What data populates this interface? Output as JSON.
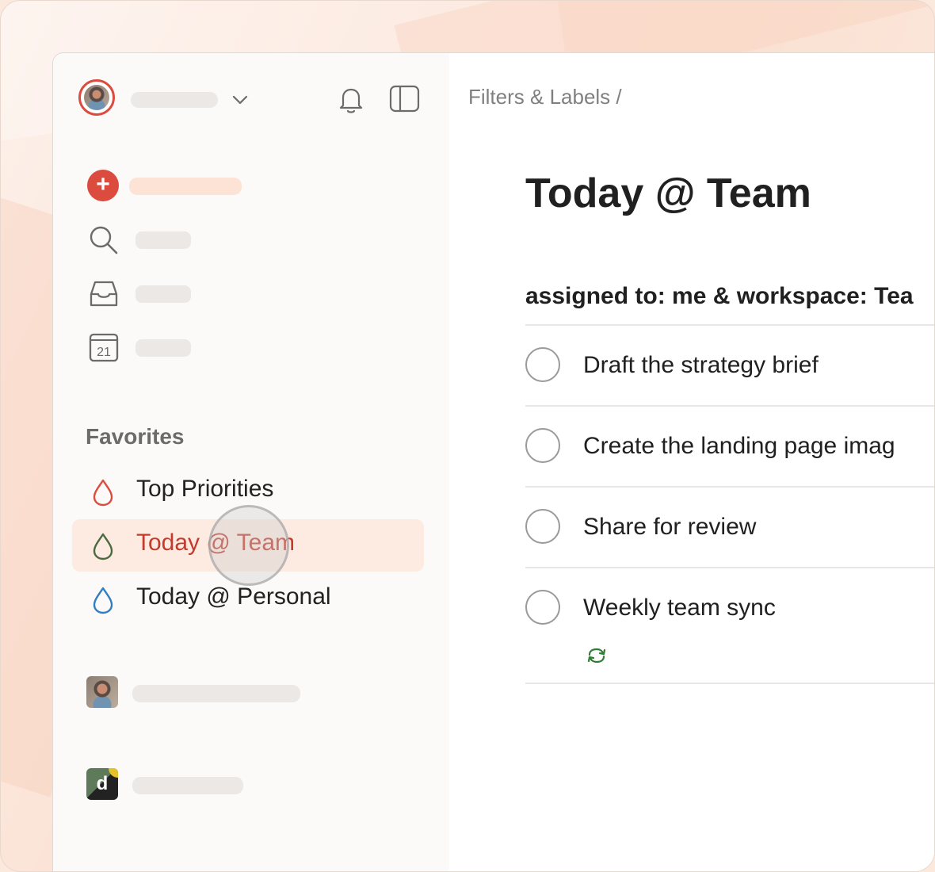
{
  "breadcrumb": {
    "text": "Filters & Labels /"
  },
  "page": {
    "title": "Today @ Team",
    "filter_query": "assigned to: me & workspace: Tea"
  },
  "sidebar": {
    "favorites_heading": "Favorites",
    "favorites": [
      {
        "label": "Top Priorities",
        "icon": "drop-icon",
        "color": "#dc4c3e",
        "active": false
      },
      {
        "label": "Today @ Team",
        "icon": "drop-icon",
        "color": "#4b6b3f",
        "active": true
      },
      {
        "label": "Today @ Personal",
        "icon": "drop-icon",
        "color": "#2f7ec4",
        "active": false
      }
    ],
    "workspace_logo_letter": "d"
  },
  "tasks": [
    {
      "title": "Draft the strategy brief",
      "recurring": false
    },
    {
      "title": "Create the landing page imag",
      "recurring": false
    },
    {
      "title": "Share for review",
      "recurring": false
    },
    {
      "title": "Weekly team sync",
      "recurring": true
    }
  ],
  "colors": {
    "accent": "#dc4c3e",
    "active_item_bg": "#fdeae1",
    "active_item_text": "#c43a2c",
    "recurring_icon": "#2e7d32"
  }
}
